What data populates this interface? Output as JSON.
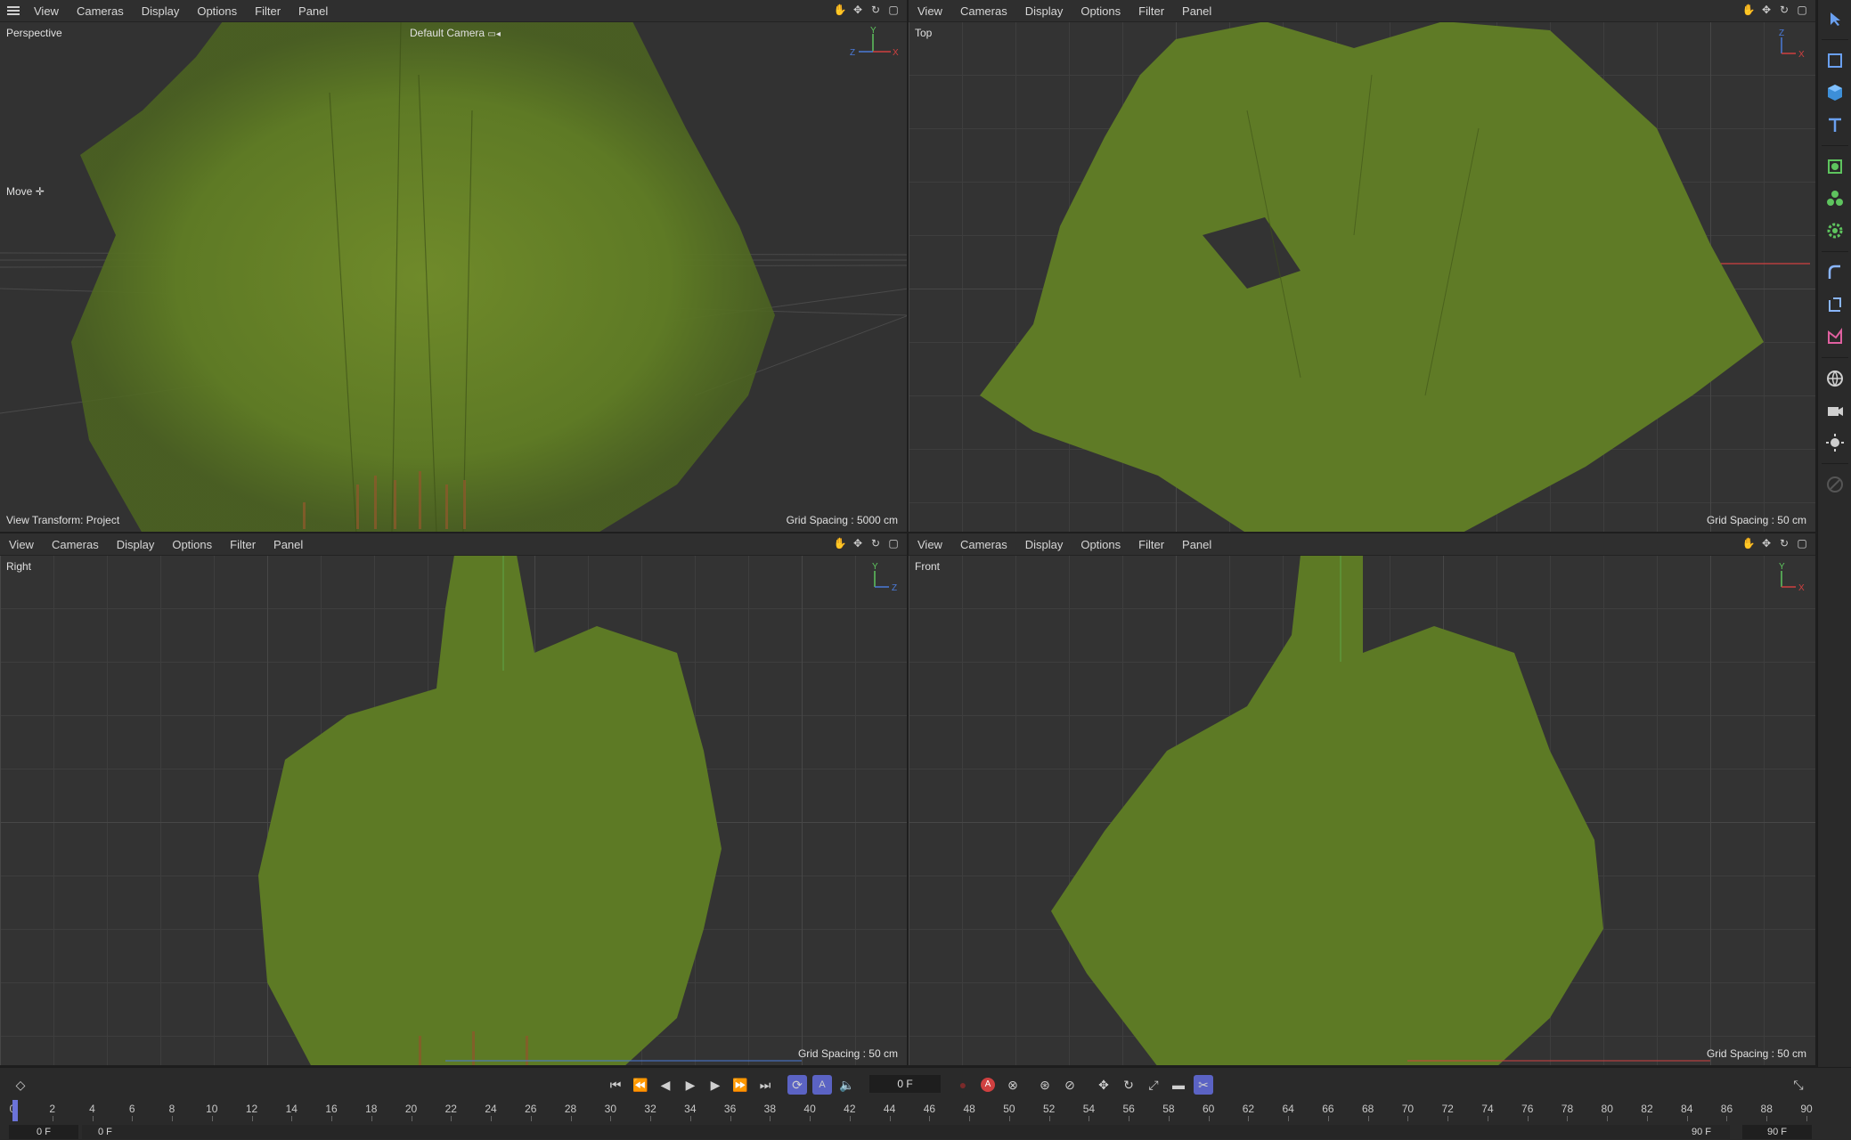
{
  "viewports": {
    "perspective": {
      "menu": [
        "View",
        "Cameras",
        "Display",
        "Options",
        "Filter",
        "Panel"
      ],
      "label": "Perspective",
      "camera": "Default Camera",
      "tool": "Move",
      "view_transform": "View Transform: Project",
      "grid_spacing": "Grid Spacing : 5000 cm",
      "axes": {
        "y": "Y",
        "z": "Z",
        "x": "X"
      }
    },
    "top": {
      "menu": [
        "View",
        "Cameras",
        "Display",
        "Options",
        "Filter",
        "Panel"
      ],
      "label": "Top",
      "grid_spacing": "Grid Spacing : 50 cm",
      "axes": {
        "z": "Z",
        "x": "X"
      }
    },
    "right": {
      "menu": [
        "View",
        "Cameras",
        "Display",
        "Options",
        "Filter",
        "Panel"
      ],
      "label": "Right",
      "grid_spacing": "Grid Spacing : 50 cm",
      "axes": {
        "y": "Y",
        "z": "Z"
      }
    },
    "front": {
      "menu": [
        "View",
        "Cameras",
        "Display",
        "Options",
        "Filter",
        "Panel"
      ],
      "label": "Front",
      "grid_spacing": "Grid Spacing : 50 cm",
      "axes": {
        "y": "Y",
        "x": "X"
      }
    }
  },
  "timeline": {
    "current_frame": "0 F",
    "ticks": [
      "0",
      "2",
      "4",
      "6",
      "8",
      "10",
      "12",
      "14",
      "16",
      "18",
      "20",
      "22",
      "24",
      "26",
      "28",
      "30",
      "32",
      "34",
      "36",
      "38",
      "40",
      "42",
      "44",
      "46",
      "48",
      "50",
      "52",
      "54",
      "56",
      "58",
      "60",
      "62",
      "64",
      "66",
      "68",
      "70",
      "72",
      "74",
      "76",
      "78",
      "80",
      "82",
      "84",
      "86",
      "88",
      "90"
    ],
    "start_field": "0 F",
    "start_field_2": "0 F",
    "end_field": "90 F",
    "end_field_2": "90 F"
  },
  "colors": {
    "accent": "#6b73d8",
    "foliage": "#6e8a2a",
    "axis_x": "#d04040",
    "axis_y": "#5ec45e",
    "axis_z": "#4a7ad8"
  }
}
